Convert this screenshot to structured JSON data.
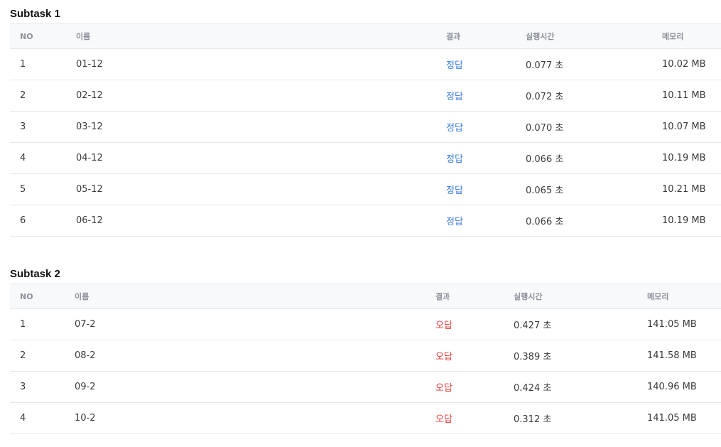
{
  "subtasks": [
    {
      "title": "Subtask 1",
      "headers": {
        "no": "NO",
        "name": "이름",
        "result": "결과",
        "time": "실행시간",
        "memory": "메모리"
      },
      "rows": [
        {
          "no": "1",
          "name": "01-12",
          "result": "정답",
          "time": "0.077 초",
          "memory": "10.02 MB"
        },
        {
          "no": "2",
          "name": "02-12",
          "result": "정답",
          "time": "0.072 초",
          "memory": "10.11 MB"
        },
        {
          "no": "3",
          "name": "03-12",
          "result": "정답",
          "time": "0.070 초",
          "memory": "10.07 MB"
        },
        {
          "no": "4",
          "name": "04-12",
          "result": "정답",
          "time": "0.066 초",
          "memory": "10.19 MB"
        },
        {
          "no": "5",
          "name": "05-12",
          "result": "정답",
          "time": "0.065 초",
          "memory": "10.21 MB"
        },
        {
          "no": "6",
          "name": "06-12",
          "result": "정답",
          "time": "0.066 초",
          "memory": "10.19 MB"
        }
      ]
    },
    {
      "title": "Subtask 2",
      "headers": {
        "no": "NO",
        "name": "이름",
        "result": "결과",
        "time": "실행시간",
        "memory": "메모리"
      },
      "rows": [
        {
          "no": "1",
          "name": "07-2",
          "result": "오답",
          "time": "0.427 초",
          "memory": "141.05 MB"
        },
        {
          "no": "2",
          "name": "08-2",
          "result": "오답",
          "time": "0.389 초",
          "memory": "141.58 MB"
        },
        {
          "no": "3",
          "name": "09-2",
          "result": "오답",
          "time": "0.424 초",
          "memory": "140.96 MB"
        },
        {
          "no": "4",
          "name": "10-2",
          "result": "오답",
          "time": "0.312 초",
          "memory": "141.05 MB"
        }
      ]
    }
  ],
  "colors": {
    "correct": "#3b7ddd",
    "wrong": "#e53935"
  }
}
